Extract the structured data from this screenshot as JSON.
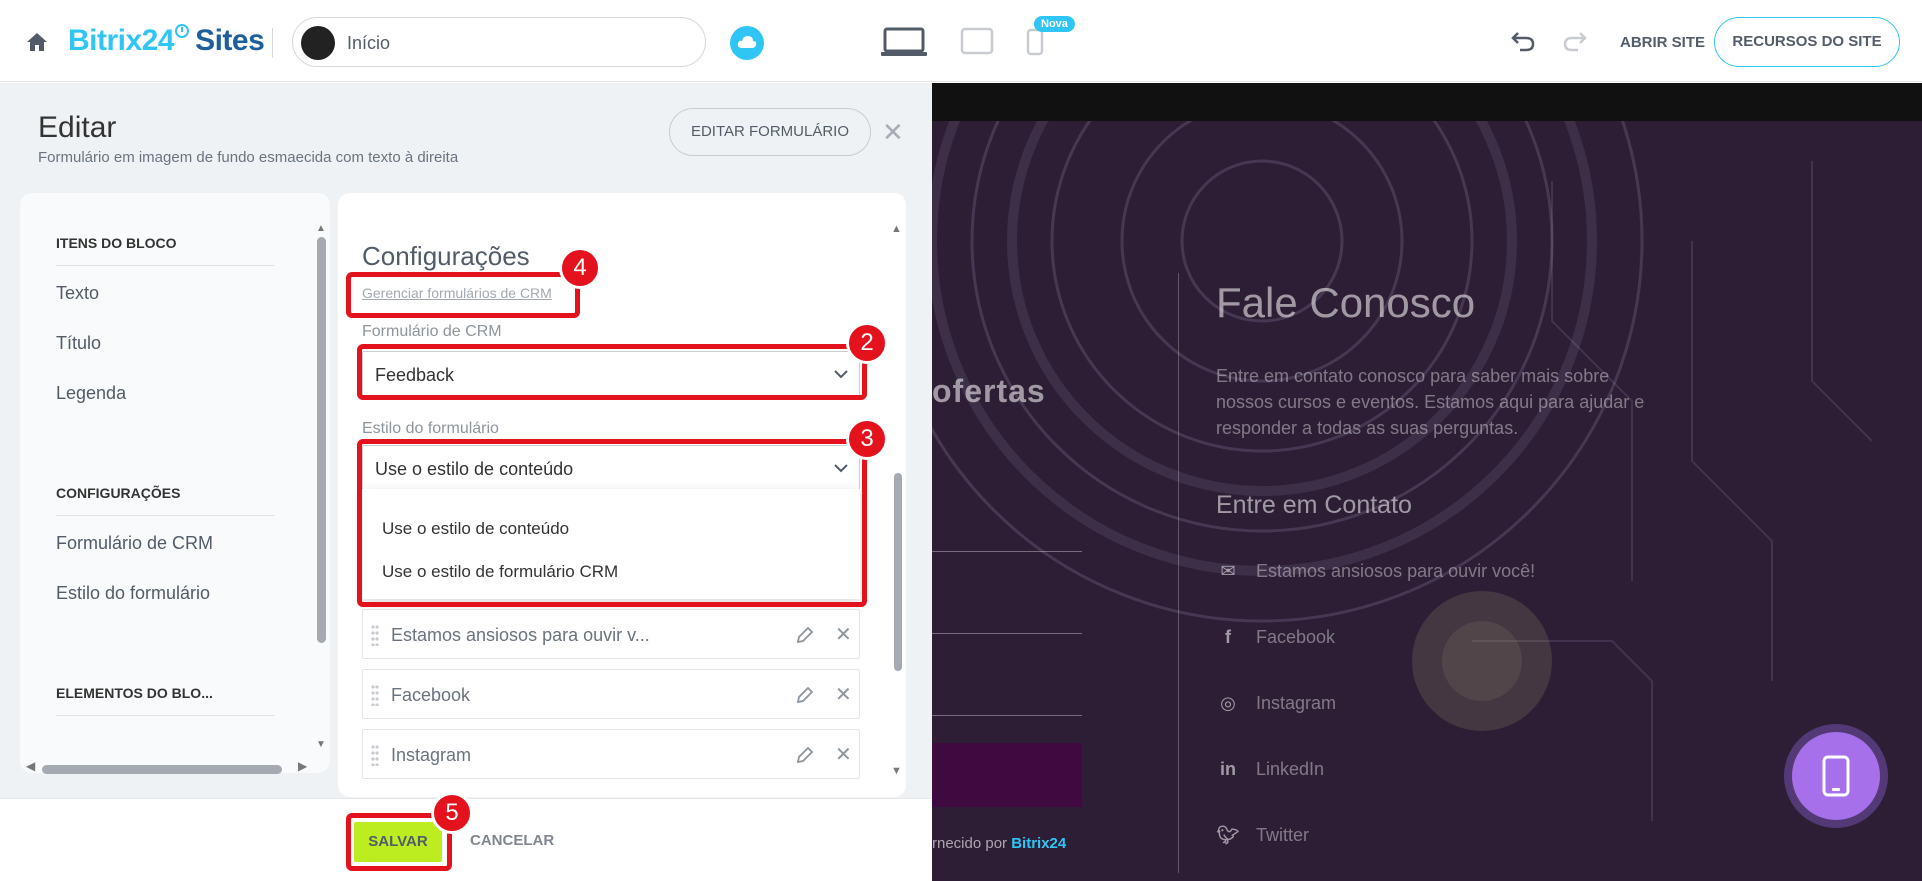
{
  "header": {
    "brand_name": "Bitrix24",
    "brand_suffix": "Sites",
    "page_selector": "Início",
    "new_badge": "Nova",
    "open_site": "ABRIR SITE",
    "site_resources": "RECURSOS DO SITE",
    "accent_color": "#2fc6f6"
  },
  "editor": {
    "title": "Editar",
    "subtitle": "Formulário em imagem de fundo esmaecida com texto à direita",
    "edit_form_button": "EDITAR FORMULÁRIO",
    "close_symbol": "✕"
  },
  "sidebar": {
    "sections": [
      {
        "heading": "ITENS DO BLOCO",
        "items": [
          "Texto",
          "Título",
          "Legenda"
        ]
      },
      {
        "heading": "CONFIGURAÇÕES",
        "items": [
          "Formulário de CRM",
          "Estilo do formulário"
        ]
      },
      {
        "heading": "ELEMENTOS DO BLO...",
        "items": []
      }
    ]
  },
  "settings": {
    "title": "Configurações",
    "manage_crm_link": "Gerenciar formulários de CRM",
    "crm_form_label": "Formulário de CRM",
    "crm_form_value": "Feedback",
    "form_style_label": "Estilo do formulário",
    "form_style_value": "Use o estilo de conteúdo",
    "form_style_options": [
      "Use o estilo de conteúdo",
      "Use o estilo de formulário CRM"
    ],
    "list_items": [
      "Estamos ansiosos para ouvir v...",
      "Facebook",
      "Instagram"
    ]
  },
  "footer": {
    "save": "SALVAR",
    "cancel": "CANCELAR",
    "save_color": "#bbed21"
  },
  "preview": {
    "left_heading": "ofertas",
    "heading": "Fale Conosco",
    "text": "Entre em contato conosco para saber mais sobre nossos cursos e eventos. Estamos aqui para ajudar e responder a todas as suas perguntas.",
    "subheading": "Entre em Contato",
    "contacts": [
      {
        "icon": "mail-icon",
        "label": "Estamos ansiosos para ouvir você!"
      },
      {
        "icon": "facebook-icon",
        "label": "Facebook"
      },
      {
        "icon": "instagram-icon",
        "label": "Instagram"
      },
      {
        "icon": "linkedin-icon",
        "label": "LinkedIn"
      },
      {
        "icon": "twitter-icon",
        "label": "Twitter"
      }
    ],
    "powered_prefix": "rnecido por",
    "powered_brand": "Bitrix24"
  },
  "annotations": {
    "badges": [
      "2",
      "3",
      "4",
      "5"
    ],
    "highlight_color": "#e3121c"
  }
}
